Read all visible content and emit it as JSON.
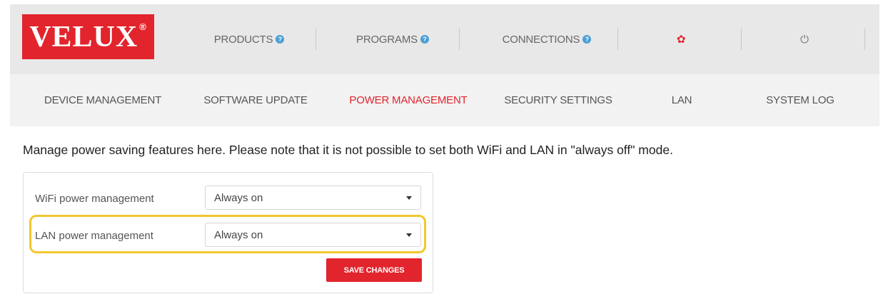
{
  "brand": {
    "logo_text": "VELUX",
    "registered_mark": "®"
  },
  "top_nav": {
    "products": "PRODUCTS",
    "programs": "PROGRAMS",
    "connections": "CONNECTIONS",
    "help_glyph": "?",
    "settings_icon": "gear-icon",
    "logout_icon": "power-icon",
    "settings_glyph": "✿",
    "logout_glyph": "⏻"
  },
  "sub_nav": {
    "device_management": "DEVICE MANAGEMENT",
    "software_update": "SOFTWARE UPDATE",
    "power_management": "POWER MANAGEMENT",
    "security_settings": "SECURITY SETTINGS",
    "lan": "LAN",
    "system_log": "SYSTEM LOG",
    "active": "POWER MANAGEMENT"
  },
  "main": {
    "notice": "Manage power saving features here. Please note that it is not possible to set both WiFi and LAN in \"always off\" mode.",
    "wifi": {
      "label": "WiFi power management",
      "value": "Always on"
    },
    "lan": {
      "label": "LAN power management",
      "value": "Always on"
    },
    "save_label": "SAVE CHANGES"
  },
  "colors": {
    "brand_red": "#e2242c",
    "highlight": "#f2c72e",
    "help_blue": "#4a9fd5"
  }
}
